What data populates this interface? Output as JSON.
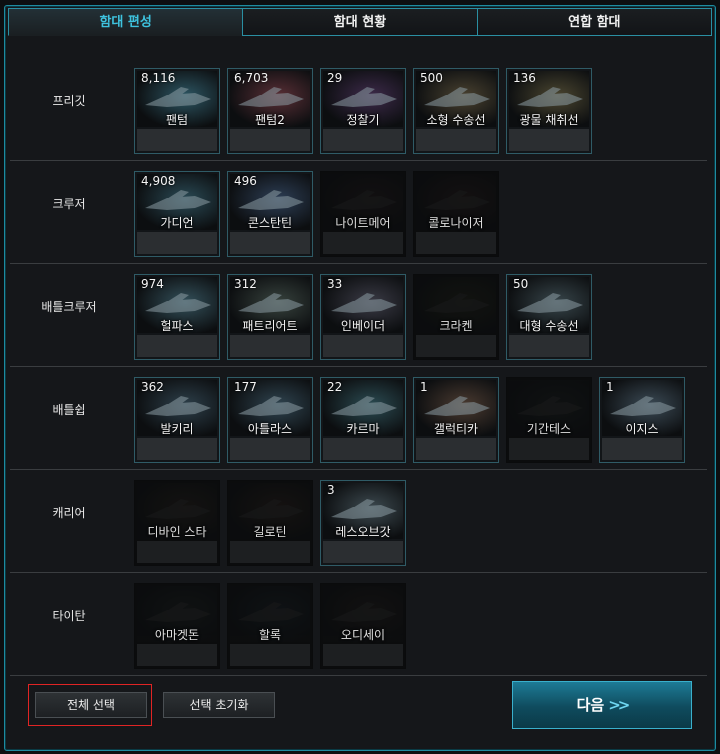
{
  "tabs": [
    {
      "label": "함대 편성",
      "active": true
    },
    {
      "label": "함대 현황",
      "active": false
    },
    {
      "label": "연합 함대",
      "active": false
    }
  ],
  "rows": [
    {
      "label": "프리깃",
      "ships": [
        {
          "count": "8,116",
          "name": "팬텀",
          "locked": false,
          "hue": "#2d5663"
        },
        {
          "count": "6,703",
          "name": "팬텀2",
          "locked": false,
          "hue": "#5a2f36"
        },
        {
          "count": "29",
          "name": "정찰기",
          "locked": false,
          "hue": "#3d2a4a"
        },
        {
          "count": "500",
          "name": "소형 수송선",
          "locked": false,
          "hue": "#4a4230"
        },
        {
          "count": "136",
          "name": "광물 채취선",
          "locked": false,
          "hue": "#4b4630"
        }
      ]
    },
    {
      "label": "크루저",
      "ships": [
        {
          "count": "4,908",
          "name": "가디언",
          "locked": false,
          "hue": "#2a4a55"
        },
        {
          "count": "496",
          "name": "콘스탄틴",
          "locked": false,
          "hue": "#2d3e55"
        },
        {
          "count": "",
          "name": "나이트메어",
          "locked": true,
          "hue": "#1b1516"
        },
        {
          "count": "",
          "name": "콜로나이저",
          "locked": true,
          "hue": "#1f1616"
        }
      ]
    },
    {
      "label": "배틀크루저",
      "ships": [
        {
          "count": "974",
          "name": "헐파스",
          "locked": false,
          "hue": "#33505a"
        },
        {
          "count": "312",
          "name": "패트리어트",
          "locked": false,
          "hue": "#37423d"
        },
        {
          "count": "33",
          "name": "인베이더",
          "locked": false,
          "hue": "#3a3a45"
        },
        {
          "count": "",
          "name": "크라켄",
          "locked": true,
          "hue": "#1b1d14"
        },
        {
          "count": "50",
          "name": "대형 수송선",
          "locked": false,
          "hue": "#37454a"
        }
      ]
    },
    {
      "label": "배틀쉽",
      "ships": [
        {
          "count": "362",
          "name": "발키리",
          "locked": false,
          "hue": "#2d3f4a"
        },
        {
          "count": "177",
          "name": "아틀라스",
          "locked": false,
          "hue": "#2f4450"
        },
        {
          "count": "22",
          "name": "카르마",
          "locked": false,
          "hue": "#2b4b52"
        },
        {
          "count": "1",
          "name": "갤럭티카",
          "locked": false,
          "hue": "#4a3a30"
        },
        {
          "count": "",
          "name": "기간테스",
          "locked": true,
          "hue": "#151919"
        },
        {
          "count": "1",
          "name": "이지스",
          "locked": false,
          "hue": "#3b4a55"
        }
      ]
    },
    {
      "label": "캐리어",
      "ships": [
        {
          "count": "",
          "name": "디바인 스타",
          "locked": true,
          "hue": "#1f1b16"
        },
        {
          "count": "",
          "name": "길로틴",
          "locked": true,
          "hue": "#221a16"
        },
        {
          "count": "3",
          "name": "레스오브갓",
          "locked": false,
          "hue": "#3d4a50"
        }
      ]
    },
    {
      "label": "타이탄",
      "ships": [
        {
          "count": "",
          "name": "아마겟돈",
          "locked": true,
          "hue": "#161a1a"
        },
        {
          "count": "",
          "name": "할록",
          "locked": true,
          "hue": "#141a1f"
        },
        {
          "count": "",
          "name": "오디세이",
          "locked": true,
          "hue": "#1b1716"
        }
      ]
    }
  ],
  "footer": {
    "select_all": "전체 선택",
    "reset_selection": "선택 초기화",
    "next": "다음",
    "next_arrows": ">>"
  }
}
